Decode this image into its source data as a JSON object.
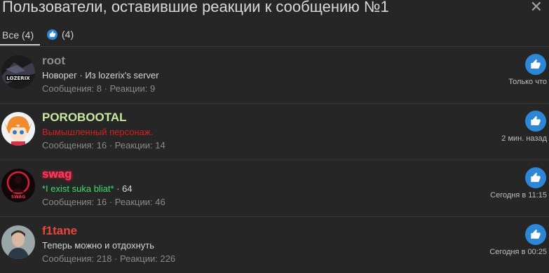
{
  "header": {
    "title": "Пользователи, оставившие реакции к сообщению №1",
    "close_symbol": "✕"
  },
  "tabs": [
    {
      "label": "Все (4)",
      "active": true
    },
    {
      "label": "(4)",
      "icon": "like-icon"
    }
  ],
  "colors": {
    "like": "#2d86d6",
    "bg": "#262626",
    "divider": "#3a3a3a"
  },
  "users": [
    {
      "name": "root",
      "name_color": "#8d8d8d",
      "title": "Новорег · Из lozerix's server",
      "title_color": "#d6d6d6",
      "stats": "Сообщения: 8 · Реакции: 9",
      "time": "Только что",
      "avatar_text": "LOZERIX",
      "reaction_icon": "like-icon"
    },
    {
      "name": "POROBOOTAL",
      "name_color": "#c9e8a0",
      "title": "Вымышленный персонаж.",
      "title_color": "#d32020",
      "stats": "Сообщения: 16 · Реакции: 14",
      "time": "2 мин. назад",
      "avatar_text": "",
      "reaction_icon": "like-icon"
    },
    {
      "name": "swag",
      "name_color": "#ff3a5c",
      "title": "*I exist suka bliat*",
      "title_color": "#3fdc6a",
      "title_extra": " · 64",
      "stats": "Сообщения: 16 · Реакции: 46",
      "time": "Сегодня в 11:15",
      "avatar_text": "SWAG",
      "reaction_icon": "like-icon"
    },
    {
      "name": "f1tane",
      "name_color": "#e8483a",
      "title": "Теперь можно и отдохнуть",
      "title_color": "#d6d6d6",
      "stats": "Сообщения: 218 · Реакции: 226",
      "time": "Сегодня в 00:25",
      "avatar_text": "",
      "reaction_icon": "like-icon"
    }
  ]
}
